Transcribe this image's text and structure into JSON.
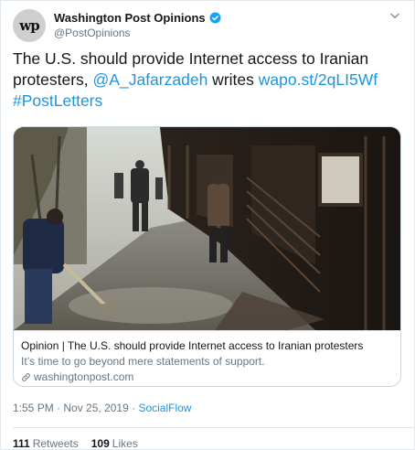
{
  "tweet": {
    "author": {
      "name": "Washington Post Opinions",
      "handle": "@PostOpinions",
      "avatar_mark": "wp",
      "verified": true
    },
    "text": {
      "part1": "The U.S. should provide Internet access to Iranian protesters, ",
      "mention": "@A_Jafarzadeh",
      "part2": " writes ",
      "url": "wapo.st/2qLI5Wf",
      "part3": " ",
      "hashtag": "#PostLetters"
    },
    "card": {
      "image_alt": "Burned storefronts on a street with people sweeping debris",
      "title": "Opinion | The U.S. should provide Internet access to Iranian protesters",
      "description": "It’s time to go beyond mere statements of support.",
      "domain": "washingtonpost.com"
    },
    "meta": {
      "time": "1:55 PM",
      "separator": " · ",
      "date": "Nov 25, 2019",
      "separator2": " · ",
      "source": "SocialFlow"
    },
    "stats": {
      "retweets_count": "111",
      "retweets_label": "Retweets",
      "likes_count": "109",
      "likes_label": "Likes"
    }
  },
  "colors": {
    "link": "#1b95e0",
    "secondary_text": "#657786",
    "border": "#e1e8ed"
  },
  "icons": [
    "verified-badge-icon",
    "chevron-down-icon",
    "link-icon"
  ]
}
